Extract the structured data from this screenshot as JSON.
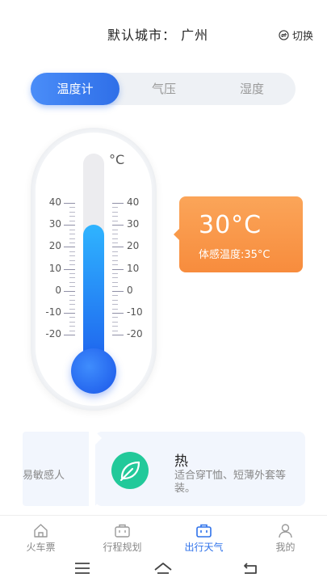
{
  "header": {
    "city_label": "默认城市： 广州",
    "switch_label": "切换"
  },
  "tabs": [
    {
      "label": "温度计",
      "active": true
    },
    {
      "label": "气压",
      "active": false
    },
    {
      "label": "湿度",
      "active": false
    }
  ],
  "thermometer": {
    "unit": "°C",
    "scale_labels": [
      "40",
      "30",
      "20",
      "10",
      "0",
      "-10",
      "-20"
    ],
    "current_temp": 30,
    "scale_min": -20,
    "scale_max": 40
  },
  "bubble": {
    "temp_text": "30°C",
    "feel_text": "体感温度:35°C"
  },
  "advice_card": {
    "prev_text": "易敏感人",
    "title": "热",
    "description": "适合穿T恤、短薄外套等装。"
  },
  "bottom_tabs": [
    {
      "label": "火车票",
      "icon": "home-icon",
      "active": false
    },
    {
      "label": "行程规划",
      "icon": "briefcase-icon",
      "active": false
    },
    {
      "label": "出行天气",
      "icon": "briefcase-icon",
      "active": true
    },
    {
      "label": "我的",
      "icon": "person-icon",
      "active": false
    }
  ],
  "colors": {
    "accent": "#2f6fe8",
    "bubble": "#f78c3d",
    "leaf": "#22c99a"
  }
}
